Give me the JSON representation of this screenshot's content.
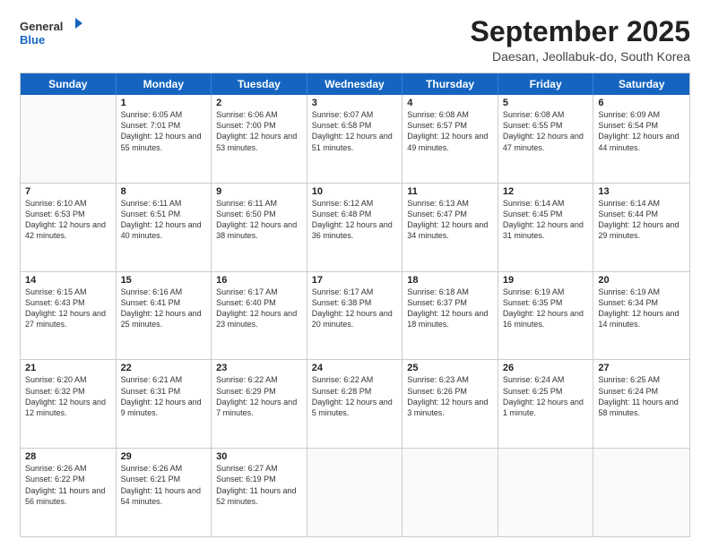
{
  "logo": {
    "general": "General",
    "blue": "Blue"
  },
  "title": "September 2025",
  "location": "Daesan, Jeollabuk-do, South Korea",
  "days_of_week": [
    "Sunday",
    "Monday",
    "Tuesday",
    "Wednesday",
    "Thursday",
    "Friday",
    "Saturday"
  ],
  "weeks": [
    [
      {
        "day": "",
        "sunrise": "",
        "sunset": "",
        "daylight": ""
      },
      {
        "day": "1",
        "sunrise": "Sunrise: 6:05 AM",
        "sunset": "Sunset: 7:01 PM",
        "daylight": "Daylight: 12 hours and 55 minutes."
      },
      {
        "day": "2",
        "sunrise": "Sunrise: 6:06 AM",
        "sunset": "Sunset: 7:00 PM",
        "daylight": "Daylight: 12 hours and 53 minutes."
      },
      {
        "day": "3",
        "sunrise": "Sunrise: 6:07 AM",
        "sunset": "Sunset: 6:58 PM",
        "daylight": "Daylight: 12 hours and 51 minutes."
      },
      {
        "day": "4",
        "sunrise": "Sunrise: 6:08 AM",
        "sunset": "Sunset: 6:57 PM",
        "daylight": "Daylight: 12 hours and 49 minutes."
      },
      {
        "day": "5",
        "sunrise": "Sunrise: 6:08 AM",
        "sunset": "Sunset: 6:55 PM",
        "daylight": "Daylight: 12 hours and 47 minutes."
      },
      {
        "day": "6",
        "sunrise": "Sunrise: 6:09 AM",
        "sunset": "Sunset: 6:54 PM",
        "daylight": "Daylight: 12 hours and 44 minutes."
      }
    ],
    [
      {
        "day": "7",
        "sunrise": "Sunrise: 6:10 AM",
        "sunset": "Sunset: 6:53 PM",
        "daylight": "Daylight: 12 hours and 42 minutes."
      },
      {
        "day": "8",
        "sunrise": "Sunrise: 6:11 AM",
        "sunset": "Sunset: 6:51 PM",
        "daylight": "Daylight: 12 hours and 40 minutes."
      },
      {
        "day": "9",
        "sunrise": "Sunrise: 6:11 AM",
        "sunset": "Sunset: 6:50 PM",
        "daylight": "Daylight: 12 hours and 38 minutes."
      },
      {
        "day": "10",
        "sunrise": "Sunrise: 6:12 AM",
        "sunset": "Sunset: 6:48 PM",
        "daylight": "Daylight: 12 hours and 36 minutes."
      },
      {
        "day": "11",
        "sunrise": "Sunrise: 6:13 AM",
        "sunset": "Sunset: 6:47 PM",
        "daylight": "Daylight: 12 hours and 34 minutes."
      },
      {
        "day": "12",
        "sunrise": "Sunrise: 6:14 AM",
        "sunset": "Sunset: 6:45 PM",
        "daylight": "Daylight: 12 hours and 31 minutes."
      },
      {
        "day": "13",
        "sunrise": "Sunrise: 6:14 AM",
        "sunset": "Sunset: 6:44 PM",
        "daylight": "Daylight: 12 hours and 29 minutes."
      }
    ],
    [
      {
        "day": "14",
        "sunrise": "Sunrise: 6:15 AM",
        "sunset": "Sunset: 6:43 PM",
        "daylight": "Daylight: 12 hours and 27 minutes."
      },
      {
        "day": "15",
        "sunrise": "Sunrise: 6:16 AM",
        "sunset": "Sunset: 6:41 PM",
        "daylight": "Daylight: 12 hours and 25 minutes."
      },
      {
        "day": "16",
        "sunrise": "Sunrise: 6:17 AM",
        "sunset": "Sunset: 6:40 PM",
        "daylight": "Daylight: 12 hours and 23 minutes."
      },
      {
        "day": "17",
        "sunrise": "Sunrise: 6:17 AM",
        "sunset": "Sunset: 6:38 PM",
        "daylight": "Daylight: 12 hours and 20 minutes."
      },
      {
        "day": "18",
        "sunrise": "Sunrise: 6:18 AM",
        "sunset": "Sunset: 6:37 PM",
        "daylight": "Daylight: 12 hours and 18 minutes."
      },
      {
        "day": "19",
        "sunrise": "Sunrise: 6:19 AM",
        "sunset": "Sunset: 6:35 PM",
        "daylight": "Daylight: 12 hours and 16 minutes."
      },
      {
        "day": "20",
        "sunrise": "Sunrise: 6:19 AM",
        "sunset": "Sunset: 6:34 PM",
        "daylight": "Daylight: 12 hours and 14 minutes."
      }
    ],
    [
      {
        "day": "21",
        "sunrise": "Sunrise: 6:20 AM",
        "sunset": "Sunset: 6:32 PM",
        "daylight": "Daylight: 12 hours and 12 minutes."
      },
      {
        "day": "22",
        "sunrise": "Sunrise: 6:21 AM",
        "sunset": "Sunset: 6:31 PM",
        "daylight": "Daylight: 12 hours and 9 minutes."
      },
      {
        "day": "23",
        "sunrise": "Sunrise: 6:22 AM",
        "sunset": "Sunset: 6:29 PM",
        "daylight": "Daylight: 12 hours and 7 minutes."
      },
      {
        "day": "24",
        "sunrise": "Sunrise: 6:22 AM",
        "sunset": "Sunset: 6:28 PM",
        "daylight": "Daylight: 12 hours and 5 minutes."
      },
      {
        "day": "25",
        "sunrise": "Sunrise: 6:23 AM",
        "sunset": "Sunset: 6:26 PM",
        "daylight": "Daylight: 12 hours and 3 minutes."
      },
      {
        "day": "26",
        "sunrise": "Sunrise: 6:24 AM",
        "sunset": "Sunset: 6:25 PM",
        "daylight": "Daylight: 12 hours and 1 minute."
      },
      {
        "day": "27",
        "sunrise": "Sunrise: 6:25 AM",
        "sunset": "Sunset: 6:24 PM",
        "daylight": "Daylight: 11 hours and 58 minutes."
      }
    ],
    [
      {
        "day": "28",
        "sunrise": "Sunrise: 6:26 AM",
        "sunset": "Sunset: 6:22 PM",
        "daylight": "Daylight: 11 hours and 56 minutes."
      },
      {
        "day": "29",
        "sunrise": "Sunrise: 6:26 AM",
        "sunset": "Sunset: 6:21 PM",
        "daylight": "Daylight: 11 hours and 54 minutes."
      },
      {
        "day": "30",
        "sunrise": "Sunrise: 6:27 AM",
        "sunset": "Sunset: 6:19 PM",
        "daylight": "Daylight: 11 hours and 52 minutes."
      },
      {
        "day": "",
        "sunrise": "",
        "sunset": "",
        "daylight": ""
      },
      {
        "day": "",
        "sunrise": "",
        "sunset": "",
        "daylight": ""
      },
      {
        "day": "",
        "sunrise": "",
        "sunset": "",
        "daylight": ""
      },
      {
        "day": "",
        "sunrise": "",
        "sunset": "",
        "daylight": ""
      }
    ]
  ]
}
